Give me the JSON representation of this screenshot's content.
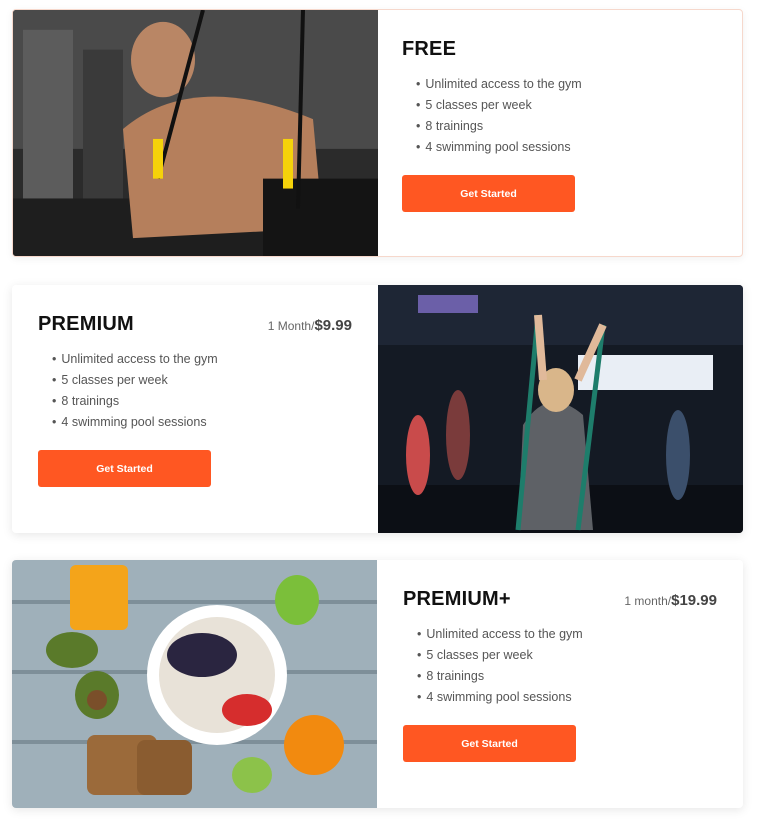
{
  "plans": [
    {
      "title": "FREE",
      "price_period": "",
      "price_amount": "",
      "features": [
        "Unlimited access to the gym",
        "5 classes per week",
        "8 trainings",
        "4 swimming pool sessions"
      ],
      "button_label": "Get Started",
      "image": "trx-workout-photo"
    },
    {
      "title": "PREMIUM",
      "price_period": "1 Month/",
      "price_amount": "$9.99",
      "features": [
        "Unlimited access to the gym",
        "5 classes per week",
        "8 trainings",
        "4 swimming pool sessions"
      ],
      "button_label": "Get Started",
      "image": "group-fitness-class-photo"
    },
    {
      "title": "PREMIUM+",
      "price_period": "1 month/",
      "price_amount": "$19.99",
      "features": [
        "Unlimited access to the gym",
        "5 classes per week",
        "8 trainings",
        "4 swimming pool sessions"
      ],
      "button_label": "Get Started",
      "image": "healthy-breakfast-photo"
    }
  ],
  "colors": {
    "accent": "#ff5722",
    "title": "#111111",
    "text": "#555555"
  }
}
